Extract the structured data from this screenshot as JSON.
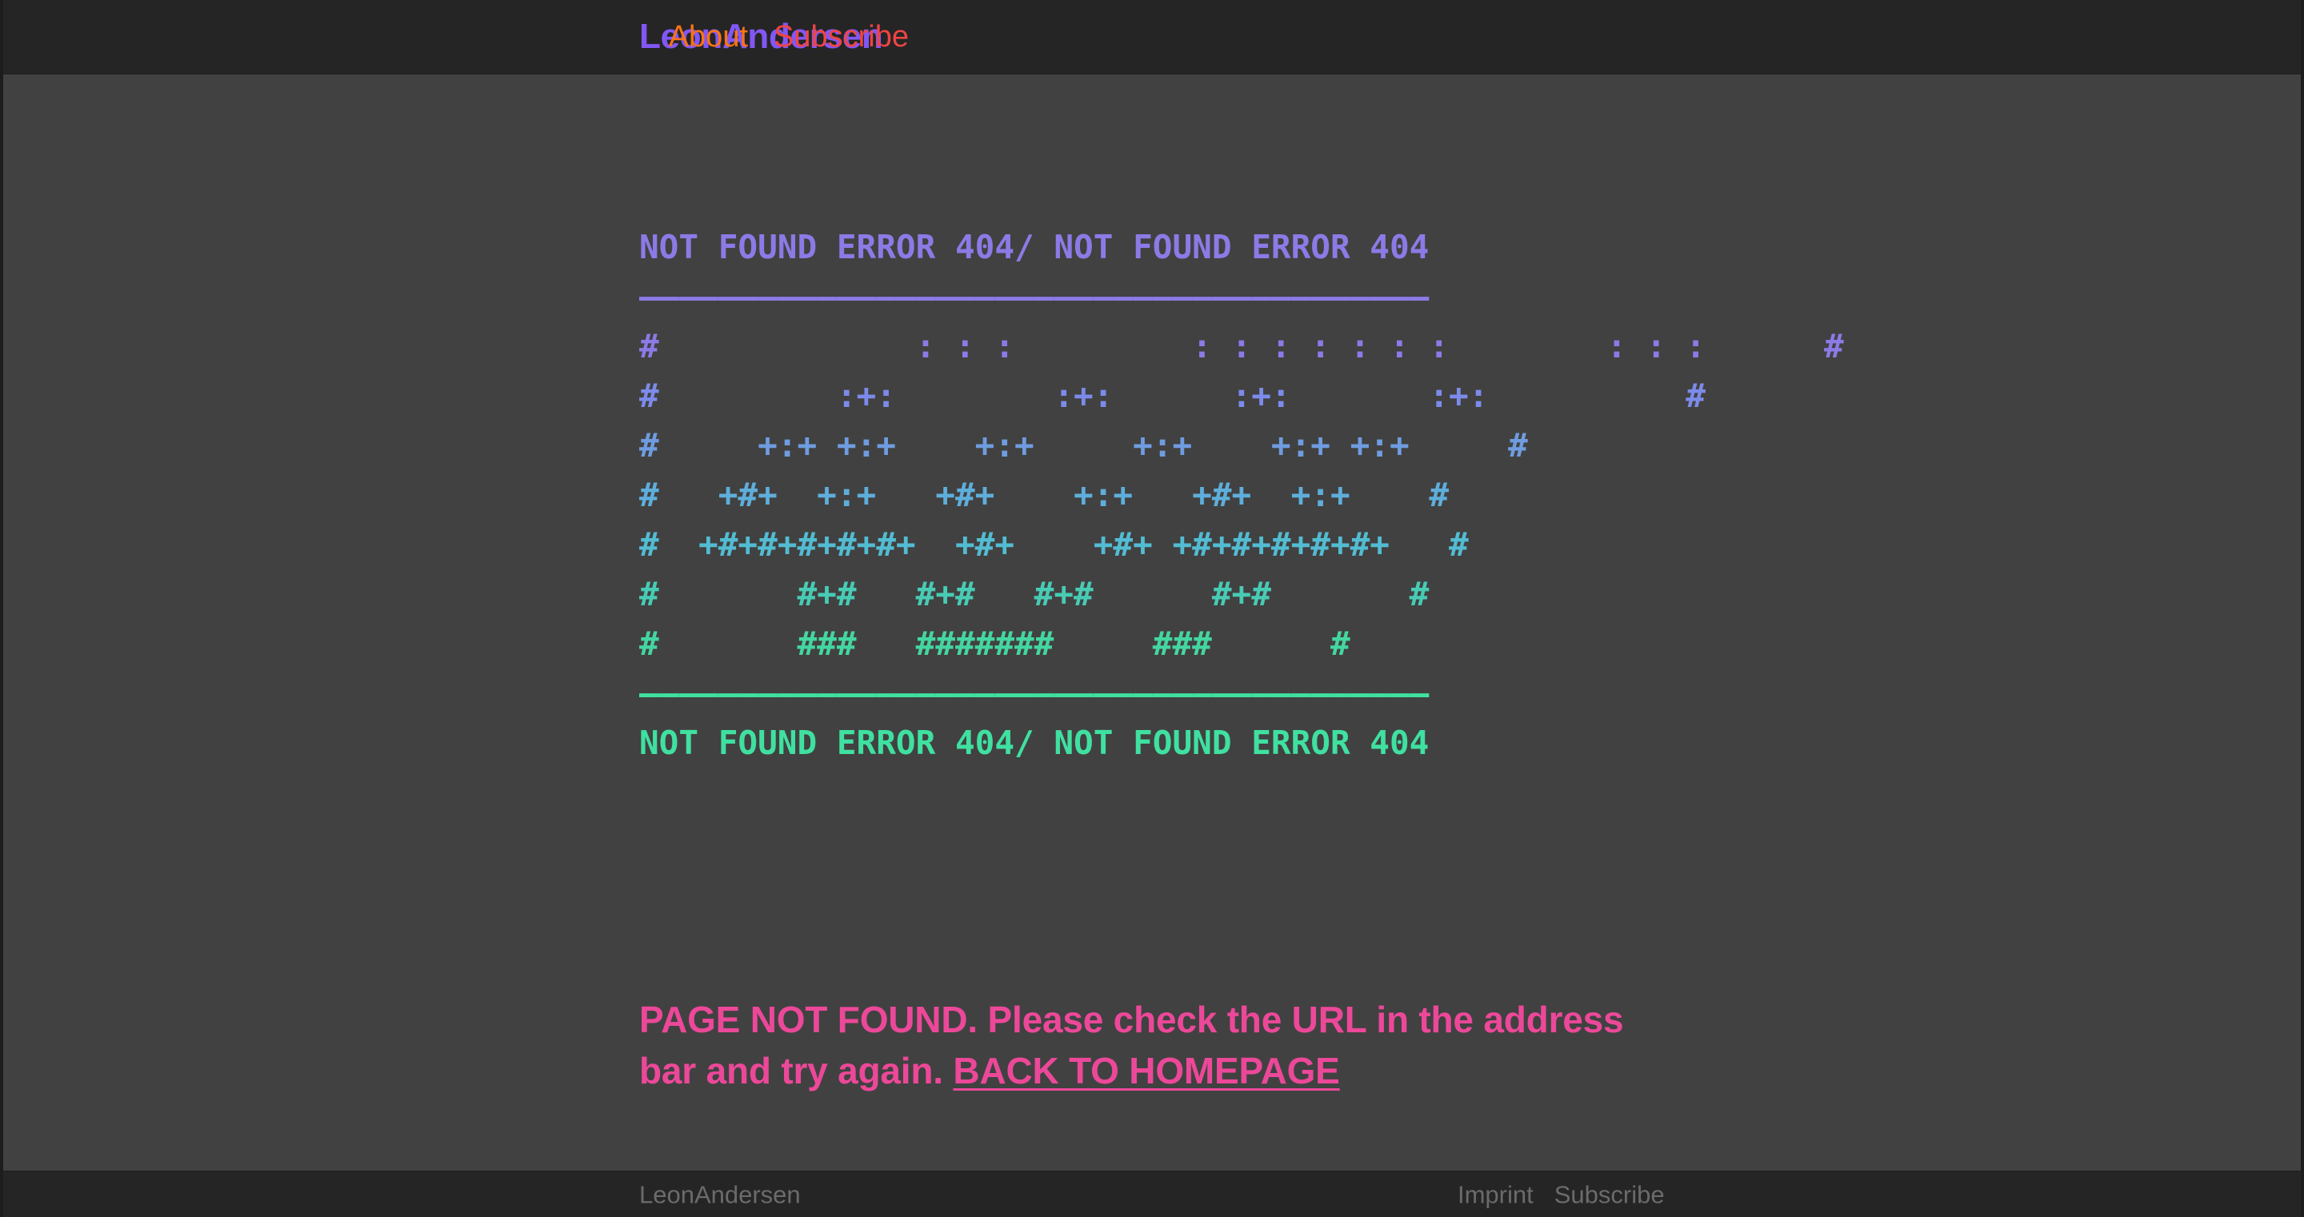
{
  "header": {
    "brand": "LeonAndersen",
    "nav": [
      {
        "label": "About",
        "color": "#f97316"
      },
      {
        "label": "Subscribe",
        "color": "#ef4444"
      }
    ]
  },
  "error_art": {
    "top_banner": "NOT FOUND ERROR 404/ NOT FOUND ERROR 404",
    "top_rule": "————————————————————————————————————————",
    "bottom_rule": "————————————————————————————————————————",
    "bottom_banner": "NOT FOUND ERROR 404/ NOT FOUND ERROR 404",
    "rows": [
      "#             : : :         : : : : : : :        : : :      #",
      "#         :+:        :+:      :+:       :+:          #",
      "#     +:+ +:+    +:+     +:+    +:+ +:+     #",
      "#   +#+  +:+   +#+    +:+   +#+  +:+    #",
      "#  +#+#+#+#+#+  +#+    +#+ +#+#+#+#+#+   #",
      "#       #+#   #+#   #+#      #+#       #",
      "#       ###   #######     ###      #"
    ],
    "colors": {
      "banner_top": "#8c7ae6",
      "banner_bottom": "#3fe0a0",
      "gradient": [
        "#8c7ae6",
        "#7c8bea",
        "#6f9ce0",
        "#5eaedb",
        "#52bcd2",
        "#48cbb4",
        "#44d6a0",
        "#3fe0a0"
      ]
    }
  },
  "message": {
    "text": "PAGE NOT FOUND. Please check the URL in the address bar and try again. ",
    "link_label": "BACK TO HOMEPAGE",
    "color": "#ec4899"
  },
  "footer": {
    "brand": "LeonAndersen",
    "links": [
      {
        "label": "Imprint"
      },
      {
        "label": "Subscribe"
      }
    ]
  },
  "theme": {
    "page_background": "#414141",
    "bar_background": "#252525",
    "edge": "#1d1d1d"
  }
}
